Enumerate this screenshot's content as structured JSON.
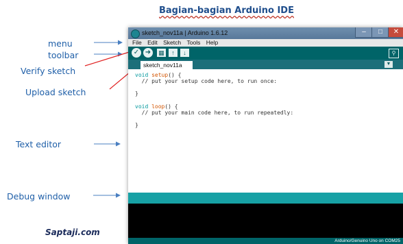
{
  "page_title": "Bagian-bagian Arduino IDE",
  "callouts": {
    "menu": "menu",
    "toolbar": "toolbar",
    "verify": "Verify sketch",
    "upload": "Upload sketch",
    "text_editor": "Text editor",
    "debug_window": "Debug window"
  },
  "footer_brand": "Saptaji.com",
  "window": {
    "title": "sketch_nov11a | Arduino 1.6.12",
    "menu": [
      "File",
      "Edit",
      "Sketch",
      "Tools",
      "Help"
    ],
    "toolbar_icons": [
      "verify-icon",
      "upload-icon",
      "new-icon",
      "open-icon",
      "save-icon",
      "serial-monitor-icon"
    ],
    "tab_label": "sketch_nov11a",
    "code": {
      "line1_kw": "void",
      "line1_fn": "setup",
      "line1_rest": "() {",
      "line2": "  // put your setup code here, to run once:",
      "line3": "}",
      "line4_kw": "void",
      "line4_fn": "loop",
      "line4_rest": "() {",
      "line5": "  // put your main code here, to run repeatedly:",
      "line6": "}"
    },
    "status": "Arduino/Genuino Uno on COM25"
  },
  "colors": {
    "arduino_teal": "#006468",
    "status_teal": "#17a1a5",
    "callout_blue": "#1f5fa8",
    "arrow_red": "#e02020"
  }
}
